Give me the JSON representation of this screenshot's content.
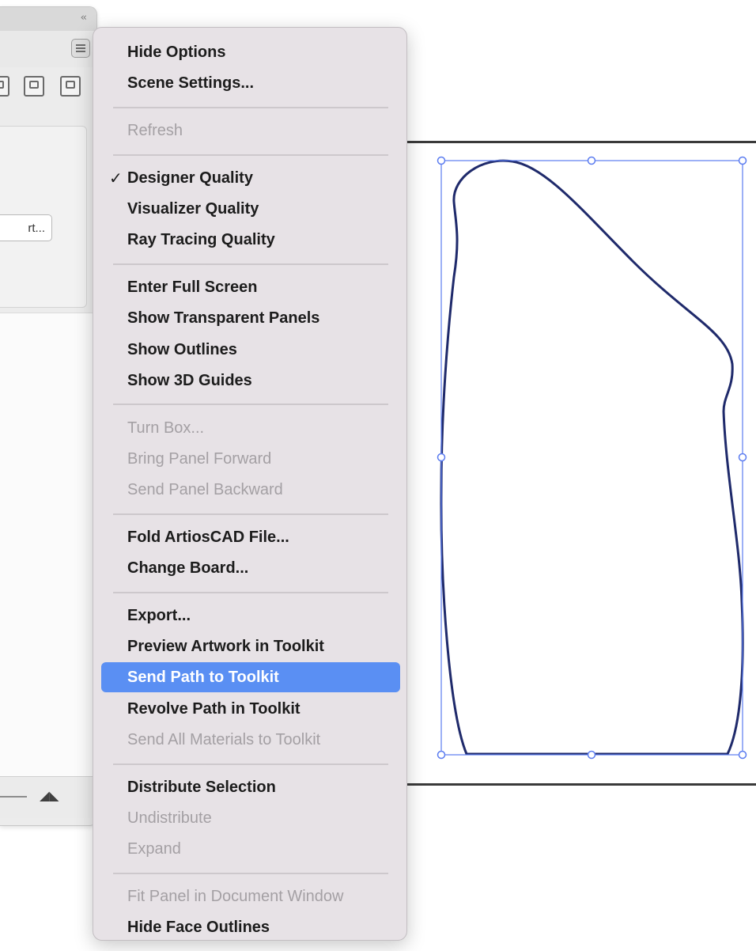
{
  "panel": {
    "collapse_icon": "double-chevron-left-icon",
    "menu_icon": "hamburger-icon",
    "tool_icons": [
      "view-icon",
      "display-icon",
      "export-icon"
    ],
    "button_label": "rt...",
    "slider_icon": "mountain-icon"
  },
  "context_menu": {
    "highlight_color": "#5a8ff3",
    "groups": [
      [
        {
          "label": "Hide Options",
          "enabled": true
        },
        {
          "label": "Scene Settings...",
          "enabled": true
        }
      ],
      [
        {
          "label": "Refresh",
          "enabled": false
        }
      ],
      [
        {
          "label": "Designer Quality",
          "enabled": true,
          "checked": true
        },
        {
          "label": "Visualizer Quality",
          "enabled": true
        },
        {
          "label": "Ray Tracing Quality",
          "enabled": true
        }
      ],
      [
        {
          "label": "Enter Full Screen",
          "enabled": true
        },
        {
          "label": "Show Transparent Panels",
          "enabled": true
        },
        {
          "label": "Show Outlines",
          "enabled": true
        },
        {
          "label": "Show 3D Guides",
          "enabled": true
        }
      ],
      [
        {
          "label": "Turn Box...",
          "enabled": false
        },
        {
          "label": "Bring Panel Forward",
          "enabled": false
        },
        {
          "label": "Send Panel Backward",
          "enabled": false
        }
      ],
      [
        {
          "label": "Fold ArtiosCAD File...",
          "enabled": true
        },
        {
          "label": "Change Board...",
          "enabled": true
        }
      ],
      [
        {
          "label": "Export...",
          "enabled": true
        },
        {
          "label": "Preview Artwork in Toolkit",
          "enabled": true
        },
        {
          "label": "Send Path to Toolkit",
          "enabled": true,
          "highlighted": true
        },
        {
          "label": "Revolve Path in Toolkit",
          "enabled": true
        },
        {
          "label": "Send All Materials to Toolkit",
          "enabled": false
        }
      ],
      [
        {
          "label": "Distribute Selection",
          "enabled": true
        },
        {
          "label": "Undistribute",
          "enabled": false
        },
        {
          "label": "Expand",
          "enabled": false
        }
      ],
      [
        {
          "label": "Fit Panel in Document Window",
          "enabled": false
        },
        {
          "label": "Hide Face Outlines",
          "enabled": true
        }
      ]
    ]
  },
  "canvas": {
    "selected_shape": "bottle-outline-path",
    "selection_color": "#5b7cf0",
    "path_color": "#1f2a6b"
  }
}
